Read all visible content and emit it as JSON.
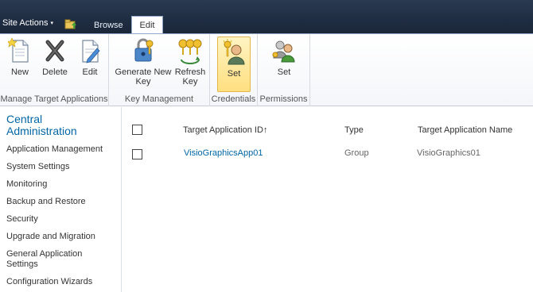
{
  "topbar": {
    "site_actions_label": "Site Actions",
    "caret": "▾",
    "nav_icon": "navigate-up-icon",
    "tabs": [
      {
        "label": "Browse",
        "selected": false
      },
      {
        "label": "Edit",
        "selected": true
      }
    ]
  },
  "ribbon": {
    "groups": [
      {
        "label": "Manage Target Applications",
        "buttons": [
          {
            "label": "New",
            "icon": "new-document-icon"
          },
          {
            "label": "Delete",
            "icon": "delete-x-icon"
          },
          {
            "label": "Edit",
            "icon": "edit-document-icon"
          }
        ]
      },
      {
        "label": "Key Management",
        "buttons": [
          {
            "label_line1": "Generate New",
            "label_line2": "Key",
            "icon": "lock-key-icon"
          },
          {
            "label_line1": "Refresh",
            "label_line2": "Key",
            "icon": "refresh-keys-icon"
          }
        ]
      },
      {
        "label": "Credentials",
        "buttons": [
          {
            "label": "Set",
            "icon": "user-key-icon",
            "active": true
          }
        ]
      },
      {
        "label": "Permissions",
        "buttons": [
          {
            "label": "Set",
            "icon": "users-permissions-icon"
          }
        ]
      }
    ]
  },
  "leftnav": {
    "title_line1": "Central",
    "title_line2": "Administration",
    "items": [
      "Application Management",
      "System Settings",
      "Monitoring",
      "Backup and Restore",
      "Security",
      "Upgrade and Migration",
      "General Application",
      "Settings",
      "Configuration Wizards"
    ]
  },
  "table": {
    "columns": [
      "Target Application ID↑",
      "Type",
      "Target Application Name"
    ],
    "rows": [
      {
        "id": "VisioGraphicsApp01",
        "type": "Group",
        "name": "VisioGraphics01"
      }
    ]
  },
  "colors": {
    "topbar": "#1f2d42",
    "link": "#0066a6",
    "active_button": "#ffdf80"
  }
}
